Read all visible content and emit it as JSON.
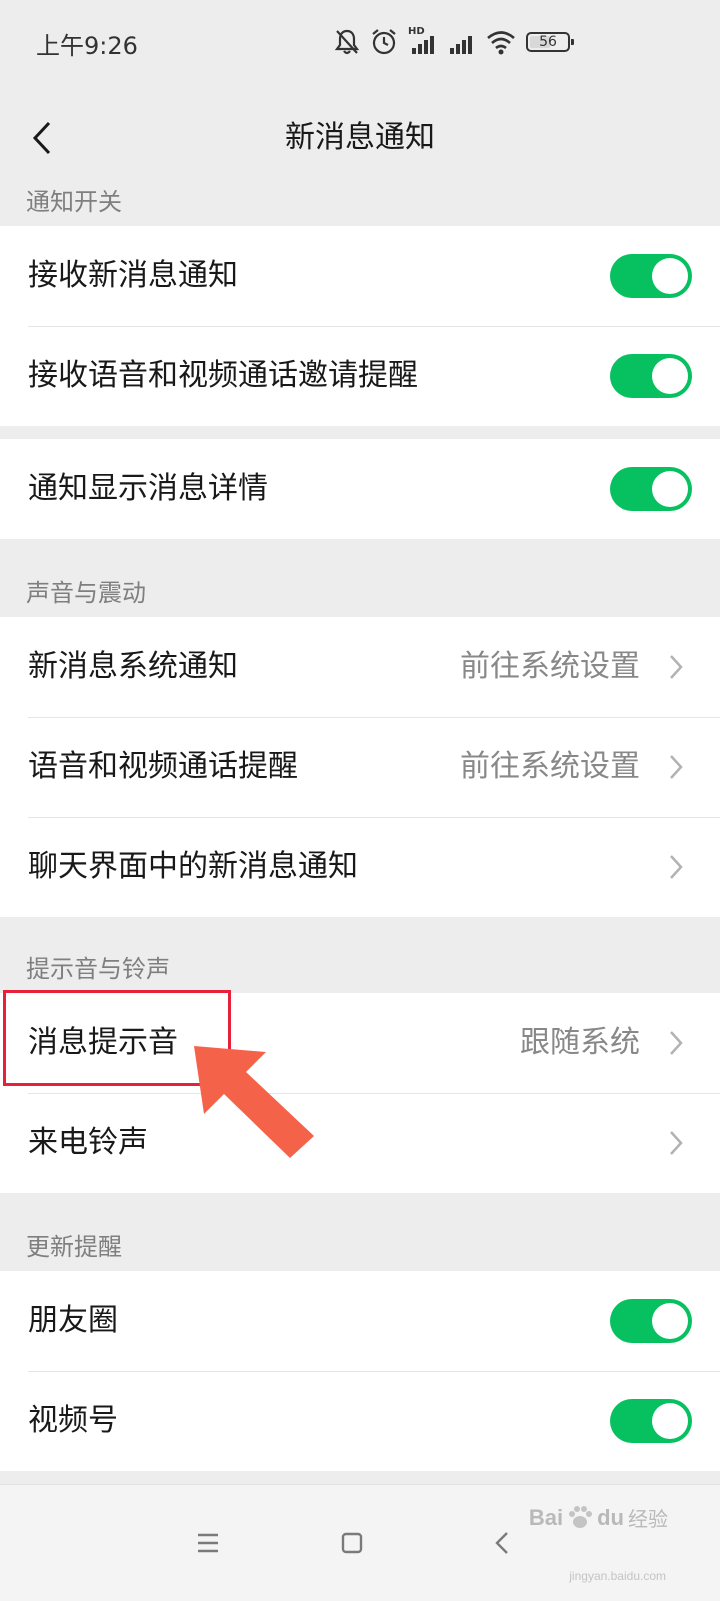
{
  "status_bar": {
    "time": "上午9:26",
    "battery": "56",
    "battery_level": 0.56,
    "network_badge": "HD",
    "icons": [
      "mute-bell-icon",
      "alarm-icon",
      "hd-signal-icon",
      "signal-icon",
      "wifi-icon",
      "battery-icon"
    ]
  },
  "nav": {
    "title": "新消息通知",
    "back_icon": "chevron-left-icon"
  },
  "sections": {
    "notify_switch": {
      "header": "通知开关",
      "rows": [
        {
          "label": "接收新消息通知",
          "toggle": true
        },
        {
          "label": "接收语音和视频通话邀请提醒",
          "toggle": true
        }
      ]
    },
    "detail": {
      "rows": [
        {
          "label": "通知显示消息详情",
          "toggle": true
        }
      ]
    },
    "sound": {
      "header": "声音与震动",
      "rows": [
        {
          "label": "新消息系统通知",
          "value": "前往系统设置"
        },
        {
          "label": "语音和视频通话提醒",
          "value": "前往系统设置"
        },
        {
          "label": "聊天界面中的新消息通知",
          "value": ""
        }
      ]
    },
    "ringtone": {
      "header": "提示音与铃声",
      "rows": [
        {
          "label": "消息提示音",
          "value": "跟随系统"
        },
        {
          "label": "来电铃声",
          "value": ""
        }
      ]
    },
    "updates": {
      "header": "更新提醒",
      "rows": [
        {
          "label": "朋友圈",
          "toggle": true
        },
        {
          "label": "视频号",
          "toggle": true
        }
      ]
    }
  },
  "annotation": {
    "highlight_color": "#e8213a",
    "arrow_color": "#f4624a"
  },
  "colors": {
    "toggle_on": "#07c160",
    "background": "#ededed"
  },
  "watermark": {
    "brand": "Bai",
    "brand_tail": "du",
    "suffix": "经验",
    "url": "jingyan.baidu.com"
  }
}
